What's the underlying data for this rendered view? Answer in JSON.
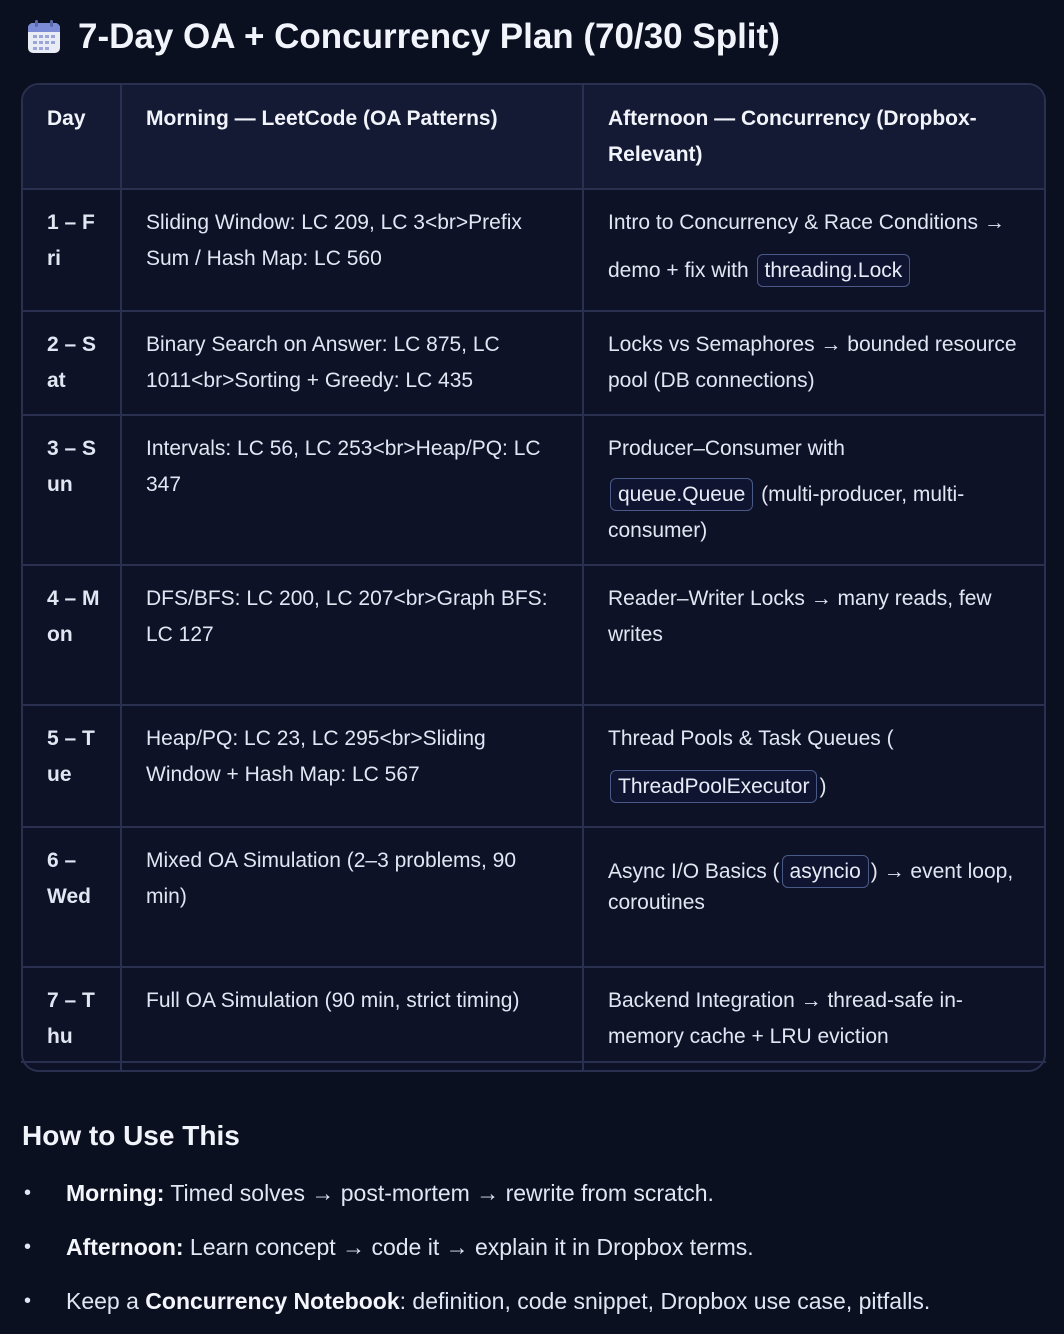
{
  "title": "7-Day OA + Concurrency Plan (70/30 Split)",
  "table": {
    "headers": [
      "Day",
      "Morning — LeetCode (OA Patterns)",
      "Afternoon — Concurrency (Dropbox-Relevant)"
    ],
    "rows": [
      {
        "day": "1 – Fri",
        "morning": "Sliding Window: LC 209, LC 3<br>Prefix Sum / Hash Map: LC 560",
        "afternoon_pre": "Intro to Concurrency & Race Conditions → demo + fix with",
        "afternoon_code": "threading.Lock",
        "afternoon_post": ""
      },
      {
        "day": "2 – Sat",
        "morning": "Binary Search on Answer: LC 875, LC 1011<br>Sorting + Greedy: LC 435",
        "afternoon_pre": "Locks vs Semaphores → bounded resource pool (DB connections)",
        "afternoon_code": "",
        "afternoon_post": ""
      },
      {
        "day": "3 – Sun",
        "morning": "Intervals: LC 56, LC 253<br>Heap/PQ: LC 347",
        "afternoon_pre": "Producer–Consumer with",
        "afternoon_code": "queue.Queue",
        "afternoon_post": "(multi-producer, multi-consumer)"
      },
      {
        "day": "4 – Mon",
        "morning": "DFS/BFS: LC 200, LC 207<br>Graph BFS: LC 127",
        "afternoon_pre": "Reader–Writer Locks → many reads, few writes",
        "afternoon_code": "",
        "afternoon_post": ""
      },
      {
        "day": "5 – Tue",
        "morning": "Heap/PQ: LC 23, LC 295<br>Sliding Window + Hash Map: LC 567",
        "afternoon_pre": "Thread Pools & Task Queues (",
        "afternoon_code": "ThreadPoolExecutor",
        "afternoon_post": ")"
      },
      {
        "day": "6 – Wed",
        "morning": "Mixed OA Simulation (2–3 problems, 90 min)",
        "afternoon_pre": "Async I/O Basics (",
        "afternoon_code": "asyncio",
        "afternoon_post": ") → event loop, coroutines"
      },
      {
        "day": "7 – Thu",
        "morning": "Full OA Simulation (90 min, strict timing)",
        "afternoon_pre": "Backend Integration → thread-safe in-memory cache + LRU eviction",
        "afternoon_code": "",
        "afternoon_post": ""
      }
    ]
  },
  "howto": {
    "heading": "How to Use This",
    "items": [
      {
        "bold": "Morning:",
        "text": " Timed solves → post-mortem → rewrite from scratch.",
        "pre": ""
      },
      {
        "bold": "Afternoon:",
        "text": " Learn concept → code it → explain it in Dropbox terms.",
        "pre": ""
      },
      {
        "pre": "Keep a ",
        "bold": "Concurrency Notebook",
        "text": ": definition, code snippet, Dropbox use case, pitfalls."
      }
    ]
  }
}
